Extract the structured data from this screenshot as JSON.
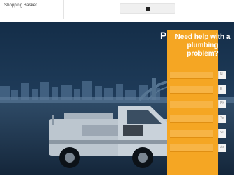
{
  "header": {
    "basket_label": "Shopping Basket",
    "basket_subtext": "",
    "menu_icon": "hamburger-menu-icon"
  },
  "hero": {
    "title": "Plumb...",
    "colors": {
      "overlay": "#1d3a5a",
      "accent": "#f5a623"
    }
  },
  "help_form": {
    "title": "Need help with a plumbing problem?",
    "fields": [
      "N",
      "E",
      "Ph",
      "Te",
      "Su",
      "Ad"
    ]
  }
}
